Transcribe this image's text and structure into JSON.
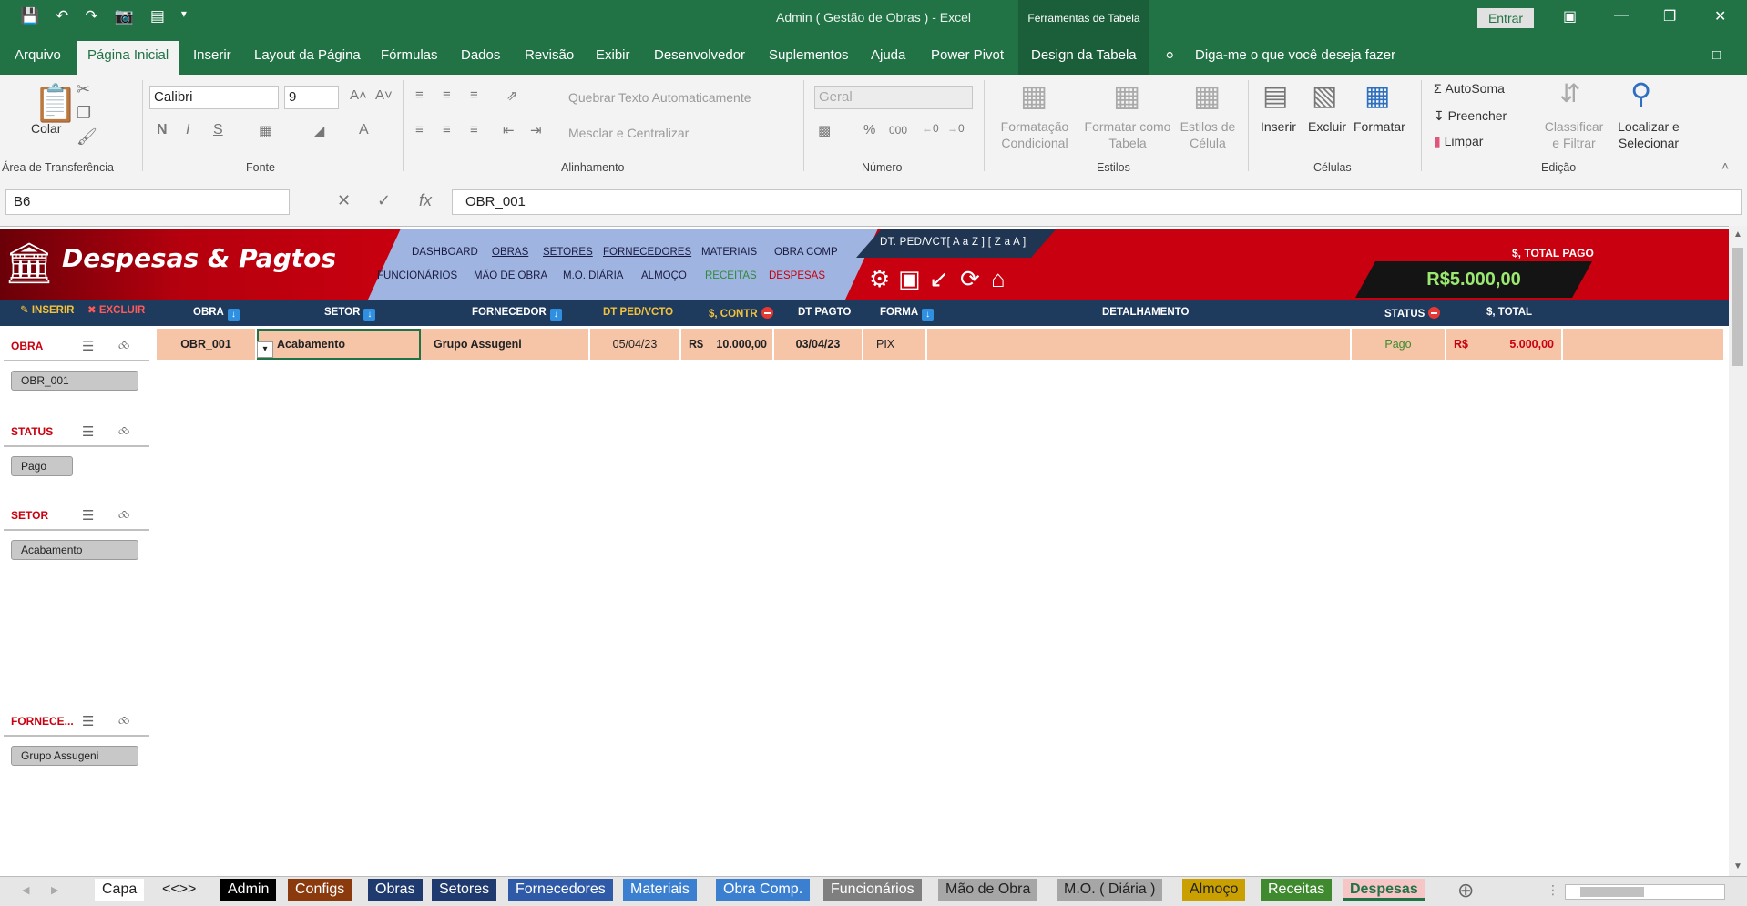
{
  "window": {
    "title": "Admin ( Gestão de Obras )  -  Excel",
    "context_tools": "Ferramentas de Tabela",
    "signin_label": "Entrar"
  },
  "ribbon_tabs": [
    "Arquivo",
    "Página Inicial",
    "Inserir",
    "Layout da Página",
    "Fórmulas",
    "Dados",
    "Revisão",
    "Exibir",
    "Desenvolvedor",
    "Suplementos",
    "Ajuda",
    "Power Pivot",
    "Design da Tabela"
  ],
  "tell_me": "Diga-me o que você deseja fazer",
  "ribbon": {
    "paste": "Colar",
    "clipboard_label": "Área de Transferência",
    "font_name": "Calibri",
    "font_size": "9",
    "font_label": "Fonte",
    "wrap_text": "Quebrar Texto Automaticamente",
    "merge_center": "Mesclar e Centralizar",
    "alignment_label": "Alinhamento",
    "number_format": "Geral",
    "number_label": "Número",
    "cond_format_1": "Formatação",
    "cond_format_2": "Condicional",
    "format_table_1": "Formatar como",
    "format_table_2": "Tabela",
    "cell_styles_1": "Estilos de",
    "cell_styles_2": "Célula",
    "styles_label": "Estilos",
    "insert": "Inserir",
    "delete": "Excluir",
    "format": "Formatar",
    "cells_label": "Células",
    "autosum": "AutoSoma",
    "fill": "Preencher",
    "clear": "Limpar",
    "sort_filter_1": "Classificar",
    "sort_filter_2": "e Filtrar",
    "find_select_1": "Localizar e",
    "find_select_2": "Selecionar",
    "editing_label": "Edição"
  },
  "formula_bar": {
    "name_box": "B6",
    "formula": "OBR_001"
  },
  "sheet": {
    "app_title": "Despesas & Pagtos",
    "nav_row1": [
      "DASHBOARD",
      "OBRAS",
      "SETORES",
      "FORNECEDORES",
      "MATERIAIS",
      "OBRA COMP"
    ],
    "nav_row2": [
      "FUNCIONÁRIOS",
      "MÃO DE OBRA",
      "M.O. DIÁRIA",
      "ALMOÇO",
      "RECEITAS",
      "DESPESAS"
    ],
    "sort_label": "DT. PED/VCT[ A a Z ] [ Z a A ]",
    "total_label": "$, TOTAL PAGO",
    "total_value": "R$5.000,00",
    "insert_label": "INSERIR",
    "delete_label": "EXCLUIR",
    "headers": [
      "OBRA",
      "SETOR",
      "FORNECEDOR",
      "DT PED/VCTO",
      "$, CONTR",
      "DT PAGTO",
      "FORMA",
      "DETALHAMENTO",
      "STATUS",
      "$, TOTAL"
    ],
    "row": {
      "obra": "OBR_001",
      "setor": "Acabamento",
      "fornecedor": "Grupo Assugeni",
      "dt_ped": "05/04/23",
      "contr_currency": "R$",
      "contr_value": "10.000,00",
      "dt_pagto": "03/04/23",
      "forma": "PIX",
      "detalhamento": "",
      "status": "Pago",
      "total_currency": "R$",
      "total_value": "5.000,00"
    },
    "slicers": [
      {
        "title": "OBRA",
        "item": "OBR_001"
      },
      {
        "title": "STATUS",
        "item": "Pago"
      },
      {
        "title": "SETOR",
        "item": "Acabamento"
      },
      {
        "title": "FORNECE...",
        "item": "Grupo Assugeni"
      }
    ]
  },
  "sheet_tabs": [
    {
      "label": "Capa",
      "color": "#ffffff",
      "text": "#222222"
    },
    {
      "label": "<<>>",
      "color": "#e6e6e6",
      "text": "#222222"
    },
    {
      "label": "Admin",
      "color": "#000000",
      "text": "#ffffff"
    },
    {
      "label": "Configs",
      "color": "#8b3a0e",
      "text": "#ffffff"
    },
    {
      "label": "Obras",
      "color": "#1f3a6e",
      "text": "#ffffff"
    },
    {
      "label": "Setores",
      "color": "#1f3a6e",
      "text": "#ffffff"
    },
    {
      "label": "Fornecedores",
      "color": "#2f5aa8",
      "text": "#ffffff"
    },
    {
      "label": "Materiais",
      "color": "#3b7fd0",
      "text": "#ffffff"
    },
    {
      "label": "Obra Comp.",
      "color": "#3b7fd0",
      "text": "#ffffff"
    },
    {
      "label": "Funcionários",
      "color": "#7f7f7f",
      "text": "#ffffff"
    },
    {
      "label": "Mão de Obra",
      "color": "#a6a6a6",
      "text": "#222222"
    },
    {
      "label": "M.O. ( Diária )",
      "color": "#a6a6a6",
      "text": "#222222"
    },
    {
      "label": "Almoço",
      "color": "#c9a000",
      "text": "#222222"
    },
    {
      "label": "Receitas",
      "color": "#3f8a2e",
      "text": "#ffffff"
    },
    {
      "label": "Despesas",
      "color": "#f6c5c5",
      "text": "#217346"
    }
  ]
}
